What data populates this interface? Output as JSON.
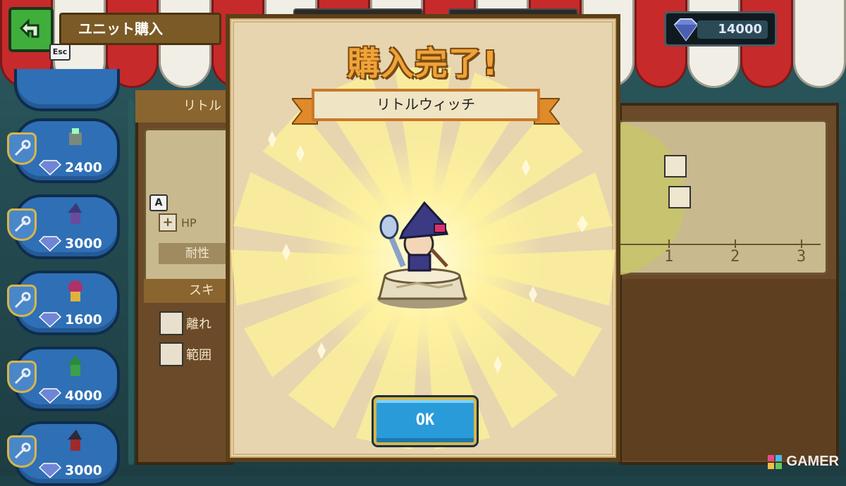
{
  "header": {
    "screen_title": "ユニット購入",
    "back_key_label": "Esc",
    "currency_amount": "14000"
  },
  "unit_list": [
    {
      "price": "2400"
    },
    {
      "price": "3000"
    },
    {
      "price": "1600"
    },
    {
      "price": "4000"
    },
    {
      "price": "3000"
    }
  ],
  "detail": {
    "tab_label": "リトル",
    "key_hint": "A",
    "hp_label": "HP",
    "resist_label": "耐性",
    "skill_tab_label": "スキ",
    "skills": [
      "離れ",
      "範囲"
    ]
  },
  "range_chart": {
    "ticks": [
      "1",
      "2",
      "3"
    ]
  },
  "modal": {
    "title": "購入完了!",
    "unit_name": "リトルウィッチ",
    "ok_label": "OK"
  },
  "watermark": "GAMER",
  "colors": {
    "ok_button": "#2a9bd9",
    "title_orange": "#f0a338",
    "modal_bg": "#e7d5b0"
  }
}
